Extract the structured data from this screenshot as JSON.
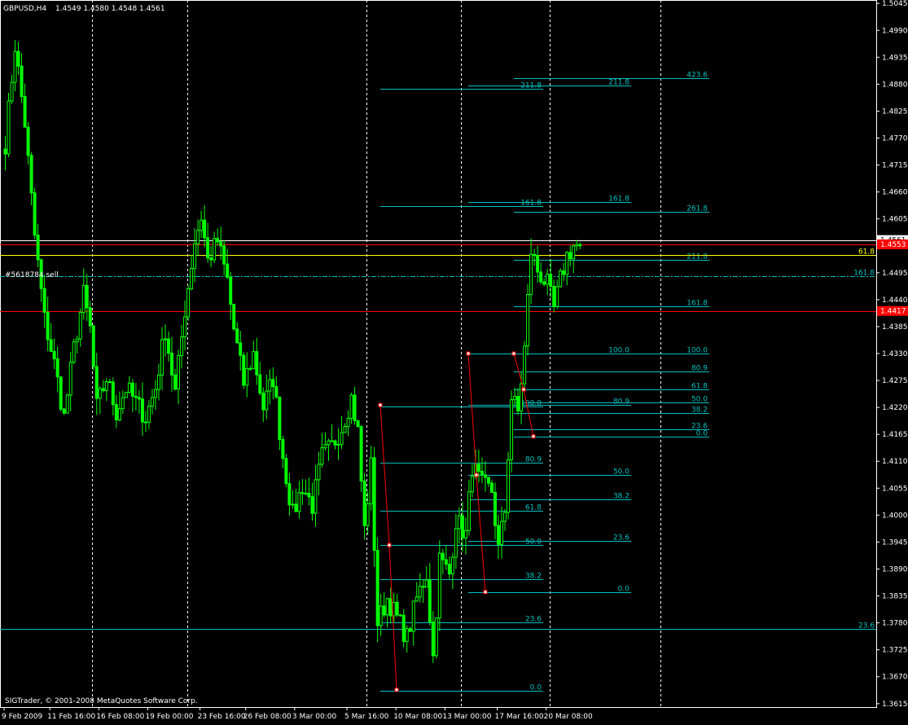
{
  "header": {
    "symbol": "GBPUSD,H4",
    "ohlc": "1.4549 1.4580 1.4548 1.4561"
  },
  "footer": {
    "copyright": "SIGTrader, © 2001-2008 MetaQuotes Software Corp."
  },
  "colors": {
    "background": "#000000",
    "candle_up": "#00ff00",
    "candle_down": "#00ff00",
    "fib": "#00c0c0",
    "red_line": "#ff0000",
    "yellow_line": "#ffff00",
    "grid": "#ffffff",
    "axis_text": "#ffffff"
  },
  "chart_data": {
    "type": "candlestick",
    "title": "",
    "y_ticks": [
      "1.5045",
      "1.4990",
      "1.4935",
      "1.4880",
      "1.4825",
      "1.4770",
      "1.4715",
      "1.4660",
      "1.4605",
      "1.4550",
      "1.4495",
      "1.4440",
      "1.4385",
      "1.4330",
      "1.4275",
      "1.4220",
      "1.4165",
      "1.4110",
      "1.4055",
      "1.4000",
      "1.3945",
      "1.3890",
      "1.3835",
      "1.3780",
      "1.3725",
      "1.3670",
      "1.3615"
    ],
    "ylim": [
      1.3608,
      1.5052
    ],
    "x_labels": [
      "9 Feb 2009",
      "11 Feb 16:00",
      "16 Feb 08:00",
      "19 Feb 00:00",
      "23 Feb 16:00",
      "26 Feb 08:00",
      "3 Mar 00:00",
      "5 Mar 16:00",
      "10 Mar 08:00",
      "13 Mar 00:00",
      "17 Mar 16:00",
      "20 Mar 08:00"
    ],
    "x_label_bars": [
      0,
      14,
      29,
      44,
      60,
      74,
      89,
      105,
      120,
      135,
      151,
      166
    ],
    "grid_bars": [
      27,
      56,
      111,
      140,
      167,
      201
    ],
    "bar_count": 202,
    "anchors": [
      [
        0,
        1.476
      ],
      [
        3,
        1.496
      ],
      [
        6,
        1.48
      ],
      [
        9,
        1.457
      ],
      [
        12,
        1.44
      ],
      [
        15,
        1.431
      ],
      [
        18,
        1.42
      ],
      [
        21,
        1.434
      ],
      [
        24,
        1.445
      ],
      [
        26,
        1.438
      ],
      [
        28,
        1.422
      ],
      [
        31,
        1.428
      ],
      [
        34,
        1.421
      ],
      [
        37,
        1.426
      ],
      [
        40,
        1.423
      ],
      [
        43,
        1.42
      ],
      [
        46,
        1.426
      ],
      [
        49,
        1.438
      ],
      [
        52,
        1.425
      ],
      [
        55,
        1.442
      ],
      [
        58,
        1.456
      ],
      [
        60,
        1.461
      ],
      [
        62,
        1.452
      ],
      [
        65,
        1.456
      ],
      [
        68,
        1.448
      ],
      [
        70,
        1.438
      ],
      [
        73,
        1.427
      ],
      [
        76,
        1.433
      ],
      [
        79,
        1.422
      ],
      [
        82,
        1.428
      ],
      [
        85,
        1.412
      ],
      [
        88,
        1.4
      ],
      [
        91,
        1.406
      ],
      [
        94,
        1.402
      ],
      [
        97,
        1.412
      ],
      [
        100,
        1.414
      ],
      [
        103,
        1.418
      ],
      [
        106,
        1.424
      ],
      [
        108,
        1.417
      ],
      [
        110,
        1.397
      ],
      [
        112,
        1.41
      ],
      [
        114,
        1.378
      ],
      [
        117,
        1.383
      ],
      [
        120,
        1.379
      ],
      [
        123,
        1.375
      ],
      [
        126,
        1.383
      ],
      [
        129,
        1.388
      ],
      [
        131,
        1.371
      ],
      [
        133,
        1.391
      ],
      [
        136,
        1.388
      ],
      [
        138,
        1.399
      ],
      [
        141,
        1.396
      ],
      [
        143,
        1.41
      ],
      [
        146,
        1.406
      ],
      [
        149,
        1.405
      ],
      [
        151,
        1.393
      ],
      [
        153,
        1.401
      ],
      [
        155,
        1.424
      ],
      [
        157,
        1.421
      ],
      [
        159,
        1.434
      ],
      [
        161,
        1.454
      ],
      [
        163,
        1.45
      ],
      [
        166,
        1.447
      ],
      [
        168,
        1.442
      ],
      [
        170,
        1.448
      ],
      [
        172,
        1.453
      ],
      [
        174,
        1.455
      ],
      [
        176,
        1.455
      ]
    ],
    "horizontal_lines": [
      {
        "price": 1.45618,
        "color": "#ffffff"
      },
      {
        "price": 1.4553,
        "color": "#ff0000",
        "label": "1.4553"
      },
      {
        "price": 1.4531,
        "color": "#ffff00",
        "label": "61.8"
      },
      {
        "price": 1.4417,
        "color": "#ff0000",
        "label": "1.4417"
      },
      {
        "price": 1.37677,
        "color": "#00c0c0",
        "label": "23.6"
      },
      {
        "price": 1.44874,
        "color": "#00c0c0",
        "dashed": true,
        "label": "161.8"
      }
    ],
    "price_tags": [
      "1.4561",
      "1.4553",
      "1.4417"
    ],
    "object_label": "#5618784 sell",
    "fib_levels": [
      {
        "x1": 467,
        "x2": 667,
        "price": 1.48715,
        "label": "211.8"
      },
      {
        "x1": 467,
        "x2": 667,
        "price": 1.46311,
        "label": "161.8"
      },
      {
        "x1": 467,
        "x2": 667,
        "price": 1.42216,
        "label": "100.0"
      },
      {
        "x1": 467,
        "x2": 667,
        "price": 1.41065,
        "label": "80.9"
      },
      {
        "x1": 467,
        "x2": 667,
        "price": 1.4009,
        "label": "61.8"
      },
      {
        "x1": 467,
        "x2": 667,
        "price": 1.39388,
        "label": "50.0"
      },
      {
        "x1": 467,
        "x2": 667,
        "price": 1.38685,
        "label": "38.2"
      },
      {
        "x1": 467,
        "x2": 667,
        "price": 1.37816,
        "label": "23.6"
      },
      {
        "x1": 467,
        "x2": 667,
        "price": 1.36411,
        "label": "0.0"
      },
      {
        "x1": 575,
        "x2": 775,
        "price": 1.48776,
        "label": "211.8"
      },
      {
        "x1": 575,
        "x2": 775,
        "price": 1.46393,
        "label": "161.8"
      },
      {
        "x1": 575,
        "x2": 775,
        "price": 1.433,
        "label": "100.0"
      },
      {
        "x1": 575,
        "x2": 775,
        "price": 1.42248,
        "label": "80.9"
      },
      {
        "x1": 575,
        "x2": 775,
        "price": 1.40819,
        "label": "50.0"
      },
      {
        "x1": 575,
        "x2": 775,
        "price": 1.40328,
        "label": "38.2"
      },
      {
        "x1": 575,
        "x2": 775,
        "price": 1.39471,
        "label": "23.6"
      },
      {
        "x1": 575,
        "x2": 775,
        "price": 1.3843,
        "label": "0.0"
      },
      {
        "x1": 631,
        "x2": 871,
        "price": 1.4892,
        "label": "423.6"
      },
      {
        "x1": 631,
        "x2": 871,
        "price": 1.46187,
        "label": "261.8"
      },
      {
        "x1": 631,
        "x2": 871,
        "price": 1.45208,
        "label": "211.8"
      },
      {
        "x1": 631,
        "x2": 871,
        "price": 1.4427,
        "label": "161.8"
      },
      {
        "x1": 631,
        "x2": 871,
        "price": 1.433,
        "label": "100.0"
      },
      {
        "x1": 631,
        "x2": 871,
        "price": 1.42938,
        "label": "80.9"
      },
      {
        "x1": 631,
        "x2": 871,
        "price": 1.42567,
        "label": "61.8"
      },
      {
        "x1": 631,
        "x2": 871,
        "price": 1.42301,
        "label": "50.0"
      },
      {
        "x1": 631,
        "x2": 871,
        "price": 1.42081,
        "label": "38.2"
      },
      {
        "x1": 631,
        "x2": 871,
        "price": 1.41758,
        "label": "23.6"
      },
      {
        "x1": 631,
        "x2": 871,
        "price": 1.41608,
        "label": "0.0"
      }
    ],
    "red_zigzags": [
      [
        [
          467,
          1.42248
        ],
        [
          478,
          1.39388
        ],
        [
          487,
          1.36433
        ]
      ],
      [
        [
          575,
          1.433
        ],
        [
          585,
          1.40819
        ],
        [
          596,
          1.3843
        ]
      ],
      [
        [
          631,
          1.433
        ],
        [
          643,
          1.42567
        ],
        [
          655,
          1.41608
        ]
      ]
    ]
  }
}
